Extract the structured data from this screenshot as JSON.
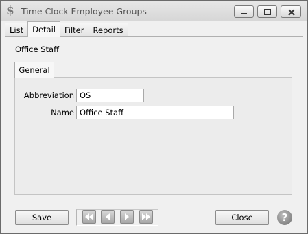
{
  "window": {
    "title": "Time Clock Employee Groups",
    "icon": "dollar-icon"
  },
  "tabs": [
    {
      "label": "List",
      "active": false
    },
    {
      "label": "Detail",
      "active": true
    },
    {
      "label": "Filter",
      "active": false
    },
    {
      "label": "Reports",
      "active": false
    }
  ],
  "detail": {
    "heading": "Office Staff",
    "subtab": "General",
    "abbreviation_label": "Abbreviation",
    "abbreviation_value": "OS",
    "name_label": "Name",
    "name_value": "Office Staff"
  },
  "footer": {
    "save_label": "Save",
    "close_label": "Close",
    "nav_icons": [
      "first-record-icon",
      "previous-record-icon",
      "next-record-icon",
      "last-record-icon"
    ],
    "help_icon": "help-icon"
  }
}
